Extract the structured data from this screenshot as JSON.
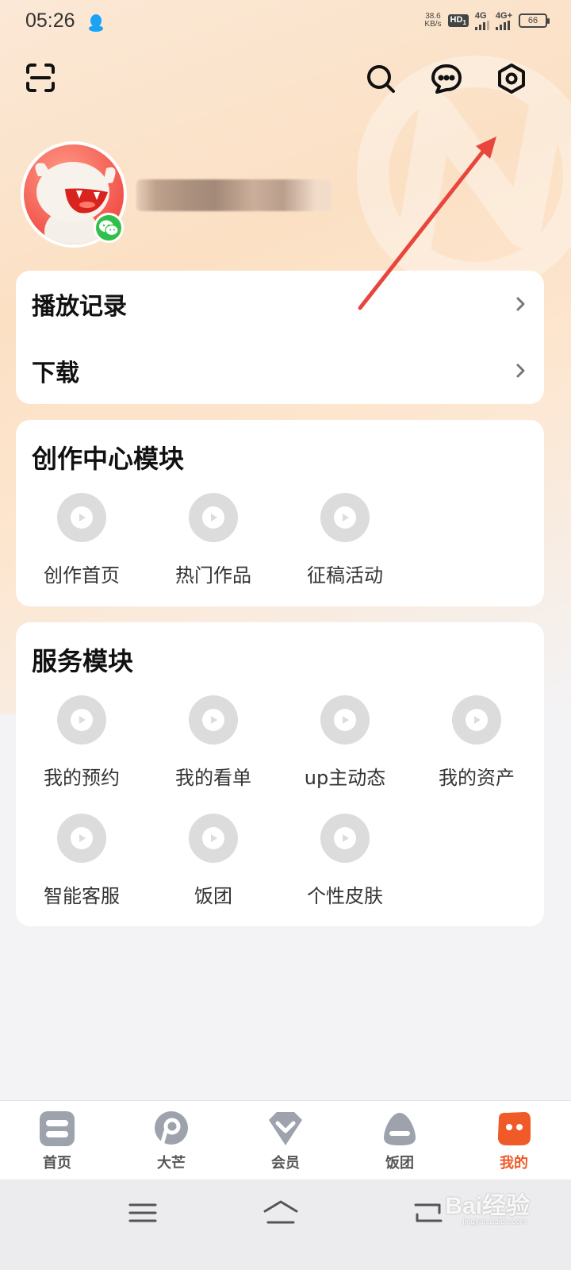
{
  "status_bar": {
    "time": "05:26",
    "net_speed_value": "38.6",
    "net_speed_unit": "KB/s",
    "hd_label": "HD",
    "hd_sub": "1",
    "signal1_label": "4G",
    "signal2_label": "4G+",
    "battery": "66"
  },
  "profile": {
    "wechat_icon": "wechat-icon"
  },
  "quick_list": {
    "items": [
      {
        "label": "播放记录"
      },
      {
        "label": "下载"
      }
    ]
  },
  "creation_module": {
    "title": "创作中心模块",
    "items": [
      {
        "label": "创作首页"
      },
      {
        "label": "热门作品"
      },
      {
        "label": "征稿活动"
      }
    ]
  },
  "service_module": {
    "title": "服务模块",
    "items": [
      {
        "label": "我的预约"
      },
      {
        "label": "我的看单"
      },
      {
        "label": "up主动态"
      },
      {
        "label": "我的资产"
      },
      {
        "label": "智能客服"
      },
      {
        "label": "饭团"
      },
      {
        "label": "个性皮肤"
      }
    ]
  },
  "bottom_nav": {
    "items": [
      {
        "label": "首页",
        "icon": "home-icon"
      },
      {
        "label": "大芒",
        "icon": "damang-icon"
      },
      {
        "label": "会员",
        "icon": "vip-icon"
      },
      {
        "label": "饭团",
        "icon": "fantuan-icon"
      },
      {
        "label": "我的",
        "icon": "me-icon",
        "active": true
      }
    ]
  },
  "watermark": {
    "text": "Bai经验",
    "sub": "jingyan.baidu.com"
  },
  "colors": {
    "accent": "#f05a28",
    "arrow": "#e8453c",
    "wechat": "#2fbf4a"
  }
}
